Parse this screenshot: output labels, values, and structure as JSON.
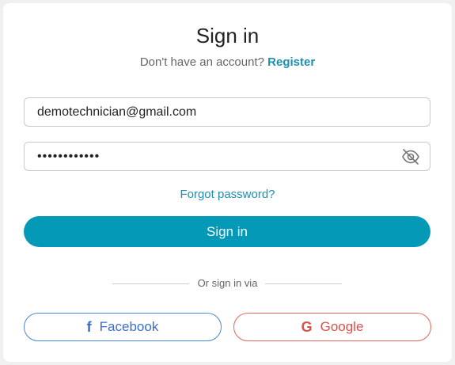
{
  "title": "Sign in",
  "subtitle": {
    "text": "Don't have an account?",
    "link": "Register"
  },
  "email": {
    "value": "demotechnician@gmail.com",
    "placeholder": ""
  },
  "password": {
    "value": "••••••••••••",
    "placeholder": ""
  },
  "icons": {
    "password_toggle": "eye-off-icon",
    "facebook": "facebook-icon",
    "google": "google-icon"
  },
  "forgot_password": "Forgot password?",
  "signin_button": "Sign in",
  "divider": "Or sign in via",
  "social": {
    "facebook": "Facebook",
    "google": "Google",
    "facebook_glyph": "f",
    "google_glyph": "G"
  },
  "colors": {
    "accent": "#0499b7",
    "link": "#1d8fb0",
    "facebook": "#3b6fc9",
    "google": "#d9534a"
  }
}
